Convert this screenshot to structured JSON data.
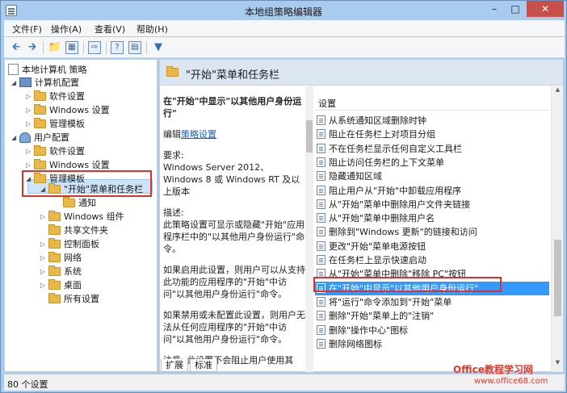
{
  "window": {
    "title": "本地组策略编辑器"
  },
  "menu": {
    "file": "文件(F)",
    "action": "操作(A)",
    "view": "查看(V)",
    "help": "帮助(H)"
  },
  "tree": {
    "root": "本地计算机 策略",
    "computer_config": "计算机配置",
    "cc_software": "软件设置",
    "cc_windows": "Windows 设置",
    "cc_admin": "管理模板",
    "user_config": "用户配置",
    "uc_software": "软件设置",
    "uc_windows": "Windows 设置",
    "uc_admin": "管理模板",
    "start_taskbar": "\"开始\"菜单和任务栏",
    "notify": "通知",
    "win_components": "Windows 组件",
    "shared_folders": "共享文件夹",
    "control_panel": "控制面板",
    "network": "网络",
    "system": "系统",
    "desktop": "桌面",
    "all_settings": "所有设置"
  },
  "right": {
    "header_title": "\"开始\"菜单和任务栏",
    "desc_heading": "在\"开始\"中显示\"以其他用户身份运行\"",
    "edit_prefix": "编辑",
    "edit_link": "策略设置",
    "req_label": "要求:",
    "req_text": "Windows Server 2012、Windows 8 或 Windows RT 及以上版本",
    "desc_label": "描述:",
    "desc_text": "此策略设置可显示或隐藏\"开始\"应用程序栏中的\"以其他用户身份运行\"命令。",
    "enabled_text": "如果启用此设置，则用户可以从支持此功能的应用程序的\"开始\"中访问\"以其他用户身份运行\"命令。",
    "disabled_text": "如果禁用或未配置此设置，则用户无法从任何应用程序的\"开始\"中访问\"以其他用户身份运行\"命令。",
    "note_text": "注意: 此设置不会阻止用户使用其",
    "column_header": "设置",
    "items": [
      "从系统通知区域删除时钟",
      "阻止在任务栏上对项目分组",
      "不在任务栏显示任何自定义工具栏",
      "阻止访问任务栏的上下文菜单",
      "隐藏通知区域",
      "阻止用户从\"开始\"中卸载应用程序",
      "从\"开始\"菜单中删除用户文件夹链接",
      "从\"开始\"菜单中删除用户名",
      "删除到\"Windows 更新\"的链接和访问",
      "更改\"开始\"菜单电源按钮",
      "在任务栏上显示快速启动",
      "从\"开始\"菜单中删除\"移除 PC\"按钮",
      "在\"开始\"中显示\"以其他用户身份运行\"",
      "将\"运行\"命令添加到\"开始\"菜单",
      "删除\"开始\"菜单上的\"注销\"",
      "删除\"操作中心\"图标",
      "删除网络图标"
    ]
  },
  "tabs": {
    "extended": "扩展",
    "standard": "标准"
  },
  "status": {
    "count": "80 个设置"
  },
  "watermark": {
    "line1": "Office教程学习网",
    "line2": "www.office68.com"
  }
}
